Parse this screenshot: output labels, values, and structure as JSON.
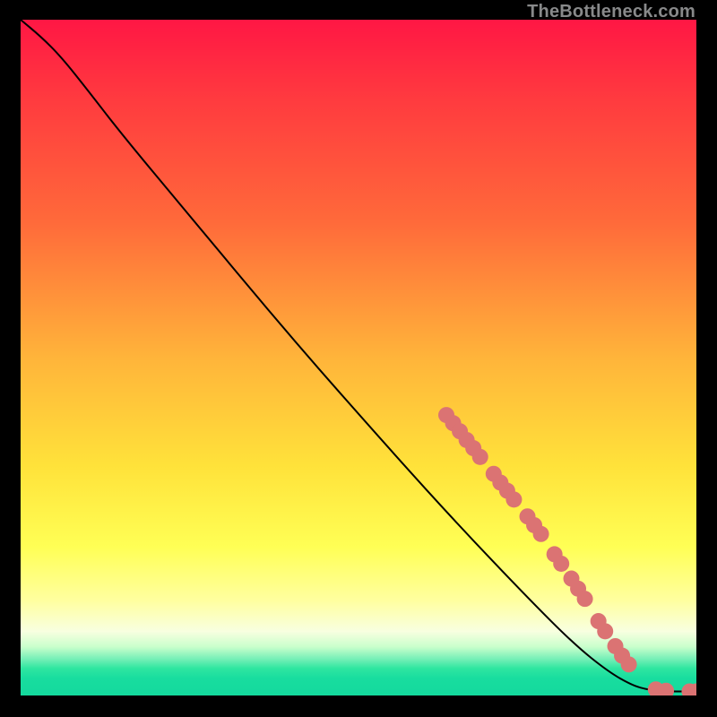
{
  "watermark": "TheBottleneck.com",
  "chart_data": {
    "type": "line",
    "title": "",
    "xlabel": "",
    "ylabel": "",
    "xlim": [
      0,
      100
    ],
    "ylim": [
      0,
      100
    ],
    "grid": false,
    "legend": false,
    "gradient_stops": [
      {
        "offset": 0.0,
        "color": "#ff1744"
      },
      {
        "offset": 0.12,
        "color": "#ff3b3f"
      },
      {
        "offset": 0.3,
        "color": "#ff6a3a"
      },
      {
        "offset": 0.5,
        "color": "#ffb43a"
      },
      {
        "offset": 0.66,
        "color": "#ffe23a"
      },
      {
        "offset": 0.78,
        "color": "#ffff55"
      },
      {
        "offset": 0.86,
        "color": "#ffffa0"
      },
      {
        "offset": 0.905,
        "color": "#f8ffe0"
      },
      {
        "offset": 0.928,
        "color": "#c9ffcc"
      },
      {
        "offset": 0.945,
        "color": "#7af0b8"
      },
      {
        "offset": 0.96,
        "color": "#2ee6a0"
      },
      {
        "offset": 0.975,
        "color": "#18dd9f"
      },
      {
        "offset": 1.0,
        "color": "#14d99d"
      }
    ],
    "curve": [
      {
        "x": 0.0,
        "y": 100.0
      },
      {
        "x": 3.0,
        "y": 97.5
      },
      {
        "x": 6.0,
        "y": 94.5
      },
      {
        "x": 10.0,
        "y": 89.5
      },
      {
        "x": 15.0,
        "y": 83.0
      },
      {
        "x": 25.0,
        "y": 71.0
      },
      {
        "x": 40.0,
        "y": 53.0
      },
      {
        "x": 55.0,
        "y": 36.0
      },
      {
        "x": 65.0,
        "y": 25.0
      },
      {
        "x": 75.0,
        "y": 14.5
      },
      {
        "x": 82.0,
        "y": 7.5
      },
      {
        "x": 87.0,
        "y": 3.5
      },
      {
        "x": 90.5,
        "y": 1.5
      },
      {
        "x": 93.0,
        "y": 0.8
      },
      {
        "x": 96.0,
        "y": 0.6
      },
      {
        "x": 100.0,
        "y": 0.6
      }
    ],
    "markers": [
      {
        "x": 63.0,
        "y": 41.5
      },
      {
        "x": 64.0,
        "y": 40.3
      },
      {
        "x": 65.0,
        "y": 39.1
      },
      {
        "x": 66.0,
        "y": 37.8
      },
      {
        "x": 67.0,
        "y": 36.6
      },
      {
        "x": 68.0,
        "y": 35.3
      },
      {
        "x": 70.0,
        "y": 32.8
      },
      {
        "x": 71.0,
        "y": 31.5
      },
      {
        "x": 72.0,
        "y": 30.3
      },
      {
        "x": 73.0,
        "y": 29.0
      },
      {
        "x": 75.0,
        "y": 26.5
      },
      {
        "x": 76.0,
        "y": 25.2
      },
      {
        "x": 77.0,
        "y": 23.9
      },
      {
        "x": 79.0,
        "y": 20.9
      },
      {
        "x": 80.0,
        "y": 19.5
      },
      {
        "x": 81.5,
        "y": 17.3
      },
      {
        "x": 82.5,
        "y": 15.8
      },
      {
        "x": 83.5,
        "y": 14.3
      },
      {
        "x": 85.5,
        "y": 11.0
      },
      {
        "x": 86.5,
        "y": 9.5
      },
      {
        "x": 88.0,
        "y": 7.3
      },
      {
        "x": 89.0,
        "y": 5.9
      },
      {
        "x": 90.0,
        "y": 4.6
      },
      {
        "x": 94.0,
        "y": 0.9
      },
      {
        "x": 95.5,
        "y": 0.7
      },
      {
        "x": 99.0,
        "y": 0.6
      },
      {
        "x": 100.0,
        "y": 0.6
      }
    ],
    "marker_color": "#db7373",
    "curve_color": "#000000"
  }
}
